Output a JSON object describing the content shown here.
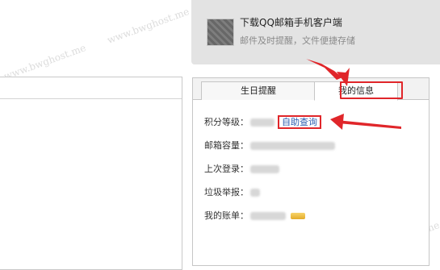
{
  "promo": {
    "title": "下载QQ邮箱手机客户端",
    "subtitle": "邮件及时提醒，文件便捷存储"
  },
  "widget": {
    "tabs": [
      {
        "label": "生日提醒",
        "active": false
      },
      {
        "label": "我的信息",
        "active": true
      }
    ],
    "rows": [
      {
        "label": "积分等级：",
        "action": "自助查询"
      },
      {
        "label": "邮箱容量："
      },
      {
        "label": "上次登录："
      },
      {
        "label": "垃圾举报："
      },
      {
        "label": "我的账单："
      }
    ]
  },
  "annotation_color": "#e0262a",
  "watermark": "www.bwghost.me"
}
